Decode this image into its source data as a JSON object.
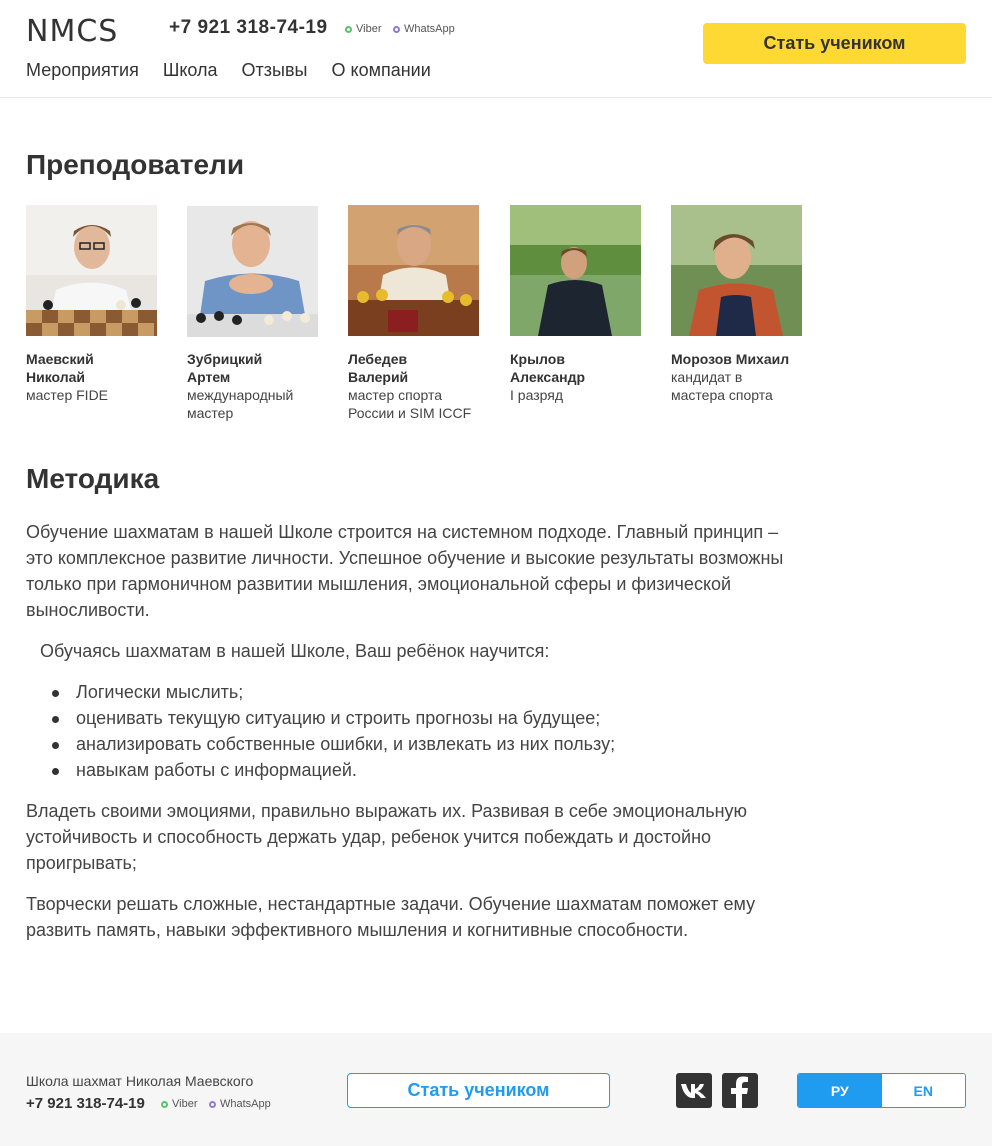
{
  "header": {
    "logo": "NMCS",
    "phone": "+7 921 318-74-19",
    "viber": "Viber",
    "whatsapp": "WhatsApp",
    "cta": "Стать учеником",
    "nav": [
      "Мероприятия",
      "Школа",
      "Отзывы",
      "О компании"
    ]
  },
  "teachers_section": {
    "title": "Преподователи",
    "items": [
      {
        "name": "Маевский Николай",
        "title": "мастер FIDE"
      },
      {
        "name": "Зубрицкий Артем",
        "title": "международный мастер"
      },
      {
        "name": "Лебедев Валерий",
        "title": "мастер спорта России и SIM ICCF"
      },
      {
        "name": "Крылов Александр",
        "title": "I разряд"
      },
      {
        "name": "Морозов Михаил",
        "title": "кандидат в мастера спорта"
      }
    ]
  },
  "method_section": {
    "title": "Методика",
    "intro": "Обучение шахматам в нашей Школе строится на системном подходе. Главный принцип – это комплексное развитие личности. Успешное обучение и высокие результаты возможны только при гармоничном развитии мышления, эмоциональной сферы и физической выносливости.",
    "lead": "Обучаясь шахматам в нашей Школе, Ваш ребёнок научится:",
    "list": [
      "Логически мыслить;",
      "оценивать текущую ситуацию и строить прогнозы на будущее;",
      "анализировать собственные ошибки, и извлекать из них пользу;",
      "навыкам работы с информацией."
    ],
    "para2": "Владеть своими эмоциями, правильно выражать их. Развивая в себе эмоциональную устойчивость и способность держать удар, ребенок учится побеждать и достойно проигрывать;",
    "para3": "Творчески решать сложные, нестандартные задачи. Обучение шахматам поможет ему развить память,  навыки эффективного мышления и когнитивные способности."
  },
  "footer": {
    "school": "Школа шахмат Николая Маевского",
    "phone": "+7 921 318-74-19",
    "viber": "Viber",
    "whatsapp": "WhatsApp",
    "cta": "Стать учеником",
    "lang_ru": "РУ",
    "lang_en": "EN"
  },
  "colors": {
    "accent_yellow": "#fed934",
    "accent_blue": "#1f9bf0"
  }
}
